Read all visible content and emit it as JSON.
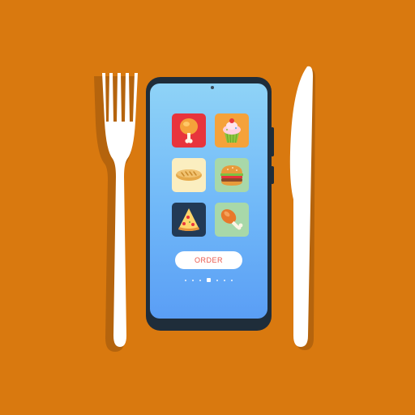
{
  "background_color": "#d9790f",
  "order_button": {
    "label": "ORDER"
  },
  "apps": [
    {
      "icon": "chicken-leg-icon",
      "color": "#e8343c"
    },
    {
      "icon": "cupcake-icon",
      "color": "#f5a23a"
    },
    {
      "icon": "bread-icon",
      "color": "#fbeec0"
    },
    {
      "icon": "burger-icon",
      "color": "#a8d8a9"
    },
    {
      "icon": "pizza-icon",
      "color": "#223a55"
    },
    {
      "icon": "roast-leg-icon",
      "color": "#a8d8a9"
    }
  ],
  "pager": {
    "count": 7,
    "active_index": 3
  }
}
